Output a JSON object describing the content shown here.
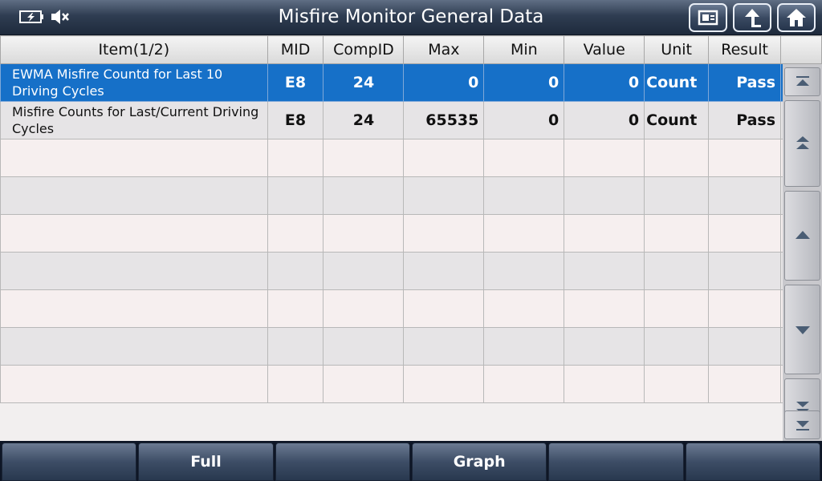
{
  "title": "Misfire Monitor General Data",
  "status": {
    "battery_icon": "battery-charging-icon",
    "sound_icon": "speaker-muted-icon"
  },
  "toolbar": {
    "icons": [
      "screenshot-icon",
      "back-icon",
      "home-icon"
    ]
  },
  "table": {
    "columns": [
      "Item(1/2)",
      "MID",
      "CompID",
      "Max",
      "Min",
      "Value",
      "Unit",
      "Result"
    ],
    "rows": [
      {
        "item": "EWMA Misfire Countd for Last 10 Driving Cycles",
        "mid": "E8",
        "compid": "24",
        "max": "0",
        "min": "0",
        "value": "0",
        "unit": "Count",
        "result": "Pass"
      },
      {
        "item": "Misfire Counts for Last/Current Driving Cycles",
        "mid": "E8",
        "compid": "24",
        "max": "65535",
        "min": "0",
        "value": "0",
        "unit": "Count",
        "result": "Pass"
      }
    ],
    "selected_row": 0
  },
  "scroll": {
    "icons": [
      "scroll-top-icon",
      "page-up-icon",
      "line-up-icon",
      "line-down-icon",
      "page-down-icon",
      "scroll-bottom-icon"
    ]
  },
  "bottom": {
    "buttons": [
      "",
      "Full",
      "",
      "Graph",
      "",
      ""
    ]
  },
  "colors": {
    "selected": "#1670c8",
    "header": "#2f3d52"
  }
}
